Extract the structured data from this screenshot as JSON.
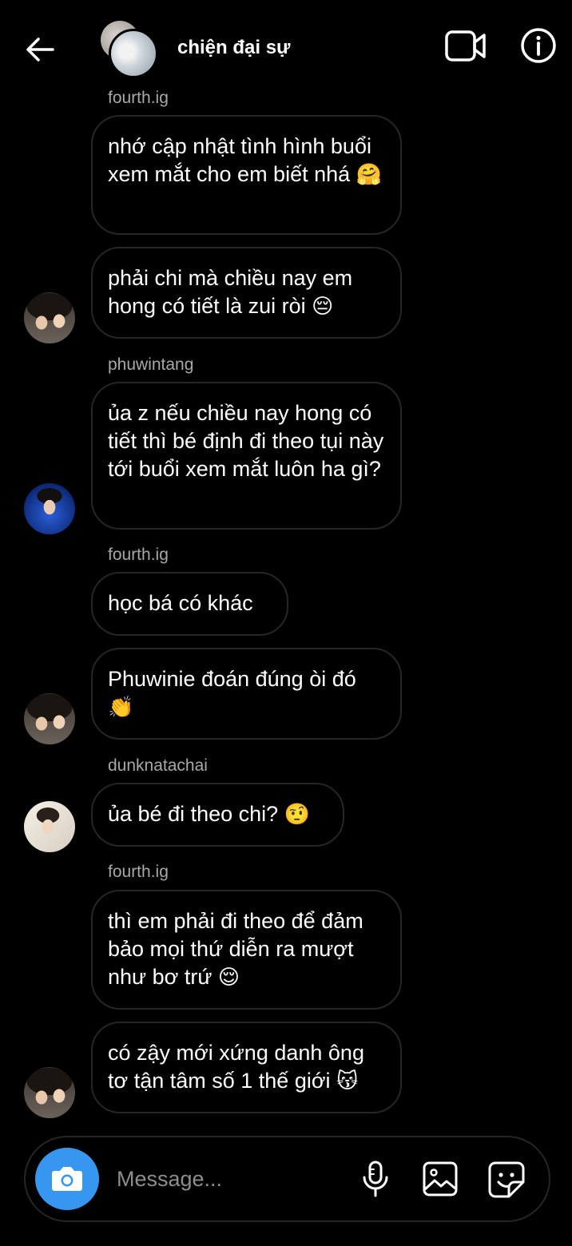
{
  "header": {
    "title": "chiện đại sự",
    "back_icon": "arrow-left-icon",
    "video_icon": "video-camera-icon",
    "info_icon": "info-icon"
  },
  "messages": [
    {
      "sender": "fourth.ig",
      "text": "nhớ cập nhật tình hình buổi xem mắt cho em biết nhá",
      "emoji": "🤗"
    },
    {
      "text": "phải chi mà chiều nay em hong có tiết là zui ròi",
      "emoji": "😔"
    },
    {
      "sender": "phuwintang",
      "text": "ủa z nếu chiều nay hong có tiết thì bé định đi theo tụi này tới buổi xem mắt luôn ha gì?"
    },
    {
      "sender": "fourth.ig",
      "text": "học bá có khác"
    },
    {
      "text": "Phuwinie đoán đúng òi đó",
      "emoji": "👏"
    },
    {
      "sender": "dunknatachai",
      "text": "ủa bé đi theo chi?",
      "emoji": "🤨"
    },
    {
      "sender": "fourth.ig",
      "text": "thì em phải đi theo để đảm bảo mọi thứ diễn ra mượt như bơ trứ",
      "emoji": "😌"
    },
    {
      "text": "có zậy mới xứng danh ông tơ tận tâm số 1 thế giới",
      "emoji": "😽"
    }
  ],
  "composer": {
    "placeholder": "Message...",
    "accent": "#3797f0",
    "camera_icon": "camera-icon",
    "mic_icon": "microphone-icon",
    "gallery_icon": "image-icon",
    "sticker_icon": "sticker-icon"
  }
}
